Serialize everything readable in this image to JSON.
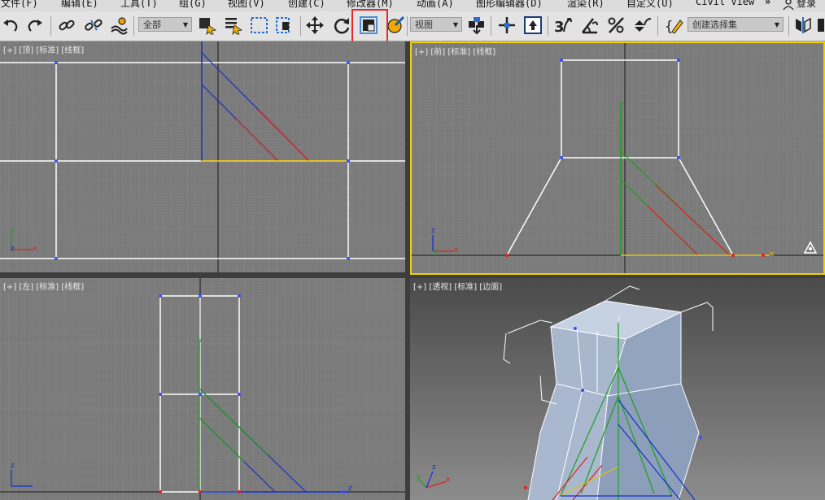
{
  "menu": {
    "items": [
      {
        "label": "文件(F)"
      },
      {
        "label": "编辑(E)"
      },
      {
        "label": "工具(T)"
      },
      {
        "label": "组(G)"
      },
      {
        "label": "视图(V)"
      },
      {
        "label": "创建(C)"
      },
      {
        "label": "修改器(M)"
      },
      {
        "label": "动画(A)"
      },
      {
        "label": "图形编辑器(D)"
      },
      {
        "label": "渲染(R)"
      },
      {
        "label": "自定义(U)"
      },
      {
        "label": "Civil View"
      }
    ],
    "overflow_label": "»",
    "login_label": "登录"
  },
  "toolbar": {
    "selection_filter": {
      "value": "全部"
    },
    "ref_coord": {
      "value": "视图"
    },
    "named_selection": {
      "value": "创建选择集"
    },
    "buttons": [
      {
        "icon": "undo-icon"
      },
      {
        "icon": "redo-icon"
      },
      {
        "icon": "link-icon"
      },
      {
        "icon": "unlink-icon"
      },
      {
        "icon": "bind-space-warp-icon"
      },
      {
        "icon": "select-object-icon"
      },
      {
        "icon": "select-by-name-icon"
      },
      {
        "icon": "rect-select-icon"
      },
      {
        "icon": "window-crossing-icon"
      },
      {
        "icon": "move-icon"
      },
      {
        "icon": "rotate-icon"
      },
      {
        "icon": "scale-icon"
      },
      {
        "icon": "placement-icon"
      },
      {
        "icon": "pivot-icon"
      },
      {
        "icon": "keyboard-shortcut-icon"
      },
      {
        "icon": "snap-3d-icon"
      },
      {
        "icon": "angle-snap-icon"
      },
      {
        "icon": "percent-snap-icon"
      },
      {
        "icon": "spinner-snap-icon"
      },
      {
        "icon": "edit-named-selection-icon"
      },
      {
        "icon": "mirror-icon"
      }
    ]
  },
  "viewports": {
    "top": {
      "label": "[+] [顶] [标准] [线框]"
    },
    "front": {
      "label": "[+] [前] [标准] [线框]"
    },
    "left": {
      "label": "[+] [左] [标准] [线框]"
    },
    "perspective": {
      "label": "[+] [透视] [标准] [边面]"
    }
  },
  "axis_labels": {
    "x": "x",
    "y": "y",
    "z": "z"
  },
  "colors": {
    "active_viewport_border": "#f0d000",
    "highlight_box": "#e8262a",
    "grid_bg": "#7b7b7b",
    "persp_bg_top": "#4a4a4a",
    "persp_bg_bottom": "#8c8c8c",
    "wire_white": "#ffffff",
    "axis_green": "#1aa01a",
    "axis_blue": "#1030d0",
    "axis_red": "#e02020",
    "mesh": "#aab8cf"
  }
}
